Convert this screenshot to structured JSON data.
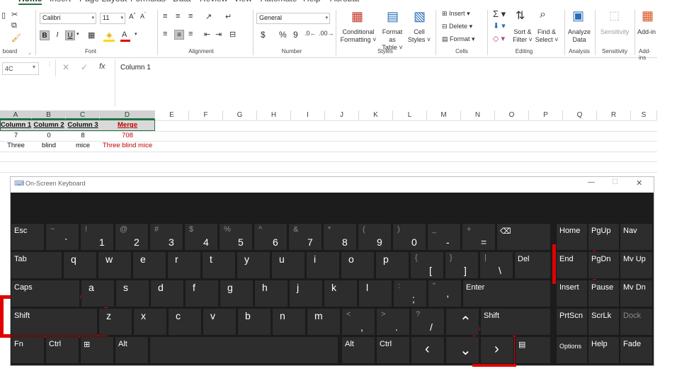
{
  "ribbon": {
    "tabs": [
      "Home",
      "Insert",
      "Page Layout",
      "Formulas",
      "Data",
      "Review",
      "View",
      "Automate",
      "Help",
      "Acrobat"
    ],
    "font_name": "Calibri",
    "font_size": "11",
    "number_format": "General",
    "groups": {
      "clipboard": "board",
      "font": "Font",
      "alignment": "Alignment",
      "number": "Number",
      "styles": "Styles",
      "cells": "Cells",
      "editing": "Editing",
      "analysis": "Analysis",
      "sensitivity": "Sensitivity",
      "addins": "Add-ins"
    },
    "buttons": {
      "conditional_formatting": [
        "Conditional",
        "Formatting ˅"
      ],
      "format_as_table": [
        "Format as",
        "Table ˅"
      ],
      "cell_styles": [
        "Cell",
        "Styles ˅"
      ],
      "insert": "Insert",
      "delete": "Delete",
      "format": "Format",
      "sort_filter": [
        "Sort &",
        "Filter ˅"
      ],
      "find_select": [
        "Find &",
        "Select ˅"
      ],
      "analyze_data": [
        "Analyze",
        "Data"
      ],
      "sensitivity": "Sensitivity",
      "addins": "Add-in"
    },
    "font_buttons": {
      "bold": "B",
      "italic": "I",
      "underline": "U"
    },
    "number_buttons": {
      "currency": "$",
      "percent": "%",
      "comma": "9"
    }
  },
  "formula_bar": {
    "name_box": "4C",
    "fx": "fx",
    "value": "Column 1"
  },
  "sheet": {
    "columns": [
      "A",
      "B",
      "C",
      "D",
      "E",
      "F",
      "G",
      "H",
      "I",
      "J",
      "K",
      "L",
      "M",
      "N",
      "O",
      "P",
      "Q",
      "R",
      "S"
    ],
    "rows": [
      [
        "Column 1",
        "Column 2",
        "Column 3",
        "Merge"
      ],
      [
        "7",
        "0",
        "8",
        "708"
      ],
      [
        "Three",
        "blind",
        "mice",
        "Three blind mice"
      ]
    ]
  },
  "osk": {
    "title": "On-Screen Keyboard",
    "row1": [
      {
        "t": "Esc"
      },
      {
        "s": "~",
        "m": "`"
      },
      {
        "s": "!",
        "m": "1"
      },
      {
        "s": "@",
        "m": "2"
      },
      {
        "s": "#",
        "m": "3"
      },
      {
        "s": "$",
        "m": "4"
      },
      {
        "s": "%",
        "m": "5"
      },
      {
        "s": "^",
        "m": "6"
      },
      {
        "s": "&",
        "m": "7"
      },
      {
        "s": "*",
        "m": "8"
      },
      {
        "s": "(",
        "m": "9"
      },
      {
        "s": ")",
        "m": "0"
      },
      {
        "s": "_",
        "m": "-"
      },
      {
        "s": "+",
        "m": "="
      },
      {
        "t": "⌫"
      },
      {
        "t": "Home"
      },
      {
        "t": "PgUp"
      },
      {
        "t": "Nav"
      }
    ],
    "row2": [
      {
        "t": "Tab"
      },
      {
        "t": "q"
      },
      {
        "t": "w"
      },
      {
        "t": "e"
      },
      {
        "t": "r"
      },
      {
        "t": "t"
      },
      {
        "t": "y"
      },
      {
        "t": "u"
      },
      {
        "t": "i"
      },
      {
        "t": "o"
      },
      {
        "t": "p"
      },
      {
        "s": "{",
        "m": "["
      },
      {
        "s": "}",
        "m": "]"
      },
      {
        "s": "|",
        "m": "\\"
      },
      {
        "t": "Del"
      },
      {
        "t": "End"
      },
      {
        "t": "PgDn"
      },
      {
        "t": "Mv Up"
      }
    ],
    "row3": [
      {
        "t": "Caps"
      },
      {
        "t": "a"
      },
      {
        "t": "s"
      },
      {
        "t": "d"
      },
      {
        "t": "f"
      },
      {
        "t": "g"
      },
      {
        "t": "h"
      },
      {
        "t": "j"
      },
      {
        "t": "k"
      },
      {
        "t": "l"
      },
      {
        "s": ":",
        "m": ";"
      },
      {
        "s": "\"",
        "m": "'"
      },
      {
        "t": "Enter"
      },
      {
        "t": "Insert"
      },
      {
        "t": "Pause"
      },
      {
        "t": "Mv Dn"
      }
    ],
    "row4": [
      {
        "t": "Shift"
      },
      {
        "t": "z"
      },
      {
        "t": "x"
      },
      {
        "t": "c"
      },
      {
        "t": "v"
      },
      {
        "t": "b"
      },
      {
        "t": "n"
      },
      {
        "t": "m"
      },
      {
        "s": "<",
        "m": ","
      },
      {
        "s": ">",
        "m": "."
      },
      {
        "s": "?",
        "m": "/"
      },
      {
        "t": "^"
      },
      {
        "t": "Shift"
      },
      {
        "t": "PrtScn"
      },
      {
        "t": "ScrLk"
      },
      {
        "t": "Dock"
      }
    ],
    "row5": [
      {
        "t": "Fn"
      },
      {
        "t": "Ctrl"
      },
      {
        "t": "⊞"
      },
      {
        "t": "Alt"
      },
      {
        "t": ""
      },
      {
        "t": "Alt"
      },
      {
        "t": "Ctrl"
      },
      {
        "t": "<"
      },
      {
        "t": "v"
      },
      {
        "t": ">"
      },
      {
        "t": "▤"
      },
      {
        "t": "Options"
      },
      {
        "t": "Help"
      },
      {
        "t": "Fade"
      }
    ]
  },
  "colors": {
    "highlight": "#e00000",
    "excel_green": "#217346",
    "merge_red": "#c00000"
  }
}
